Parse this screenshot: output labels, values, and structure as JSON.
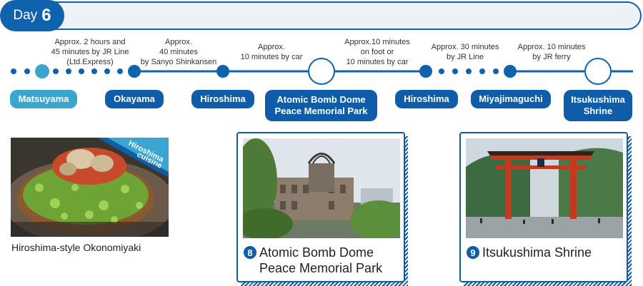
{
  "header": {
    "day_label": "Day",
    "day_number": "6"
  },
  "legs": [
    {
      "text": "Approx. 2 hours and\n45 minutes by JR Line\n(Ltd.Express)"
    },
    {
      "text": "Approx.\n40 minutes\nby Sanyo Shinkansen"
    },
    {
      "text": "Approx.\n10 minutes by car"
    },
    {
      "text": "Approx.10 minutes\non foot or\n10 minutes by car"
    },
    {
      "text": "Approx. 30 minutes\nby JR Line"
    },
    {
      "text": "Approx. 10 minutes\nby JR ferry"
    }
  ],
  "stations": [
    {
      "label": "Matsuyama"
    },
    {
      "label": "Okayama"
    },
    {
      "label": "Hiroshima"
    },
    {
      "label": "Atomic Bomb Dome\nPeace Memorial Park"
    },
    {
      "label": "Hiroshima"
    },
    {
      "label": "Miyajimaguchi"
    },
    {
      "label": "Itsukushima\nShrine"
    }
  ],
  "food": {
    "badge_line1": "Hiroshima",
    "badge_line2": "cuisine",
    "caption": "Hiroshima-style Okonomiyaki"
  },
  "spots": [
    {
      "number": "8",
      "title": "Atomic Bomb Dome\nPeace Memorial Park"
    },
    {
      "number": "9",
      "title": "Itsukushima Shrine"
    }
  ],
  "colors": {
    "primary": "#0f5ca8",
    "light": "#3aa6cf",
    "track": "#0f62ad"
  }
}
